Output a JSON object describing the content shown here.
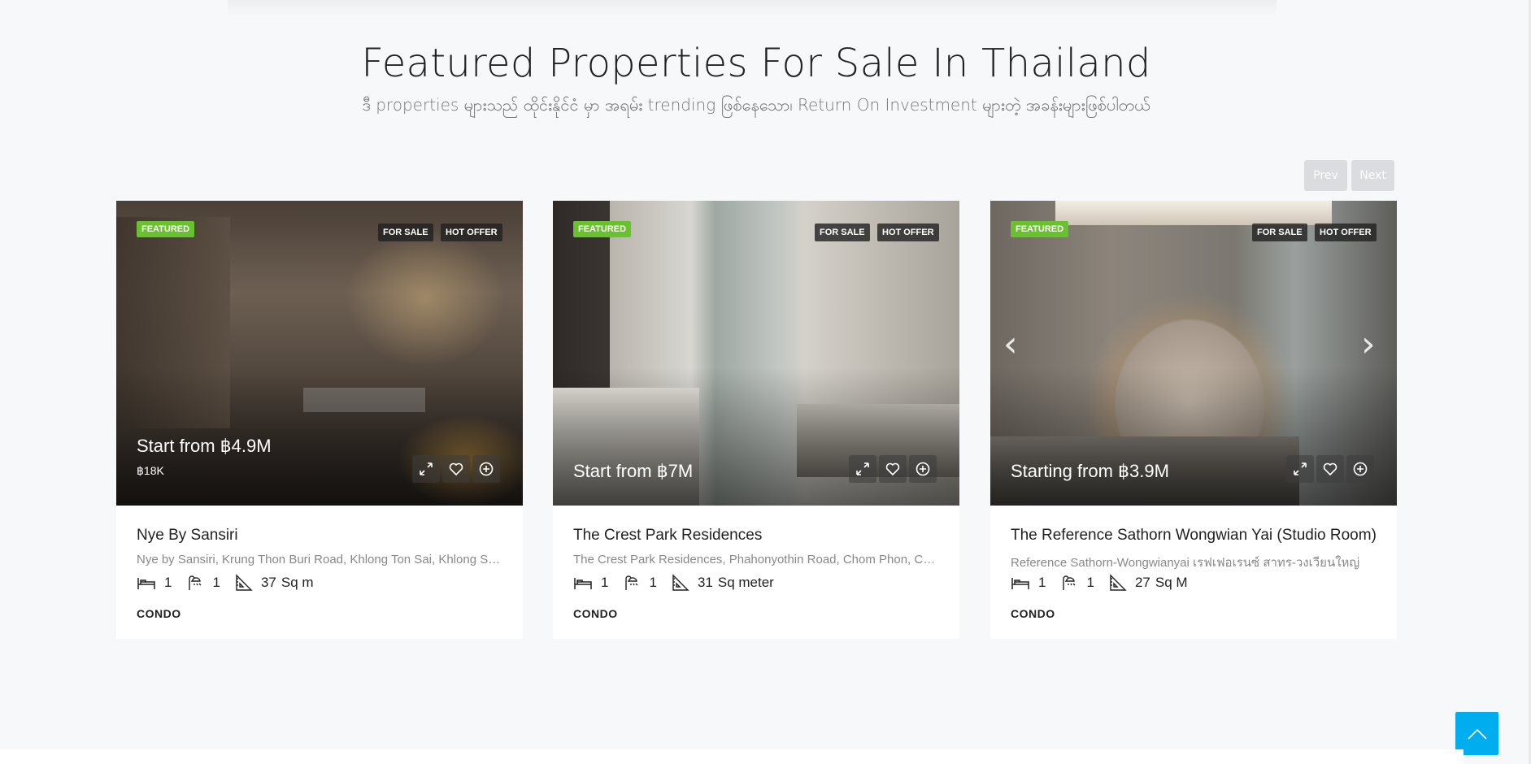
{
  "section": {
    "title": "Featured Properties For Sale In Thailand",
    "subtitle": "ဒီ properties များသည် ထိုင်းနိုင်ငံ မှာ အရမ်း trending ဖြစ်နေသော၊ Return On Investment များတဲ့ အခန်းများဖြစ်ပါတယ်"
  },
  "nav": {
    "prev_label": "Prev",
    "next_label": "Next"
  },
  "colors": {
    "featured_tag": "#68c22d",
    "accent": "#00aeef",
    "nav_button": "#dadcdf"
  },
  "cards": [
    {
      "featured": "FEATURED",
      "status": "FOR SALE",
      "offer": "HOT OFFER",
      "price": "Start from ฿4.9M",
      "price_sub": "฿18K",
      "title": "Nye By Sansiri",
      "address": "Nye by Sansiri, Krung Thon Buri Road, Khlong Ton Sai, Khlong San, Bangkok",
      "beds": "1",
      "baths": "1",
      "area": "37",
      "area_unit": "Sq m",
      "type": "CONDO"
    },
    {
      "featured": "FEATURED",
      "status": "FOR SALE",
      "offer": "HOT OFFER",
      "price": "Start from ฿7M",
      "title": "The Crest Park Residences",
      "address": "The Crest Park Residences, Phahonyothin Road, Chom Phon, Chatuchak, Bangkok",
      "beds": "1",
      "baths": "1",
      "area": "31",
      "area_unit": "Sq meter",
      "type": "CONDO"
    },
    {
      "featured": "FEATURED",
      "status": "FOR SALE",
      "offer": "HOT OFFER",
      "price": "Starting from ฿3.9M",
      "title": "The Reference Sathorn Wongwian Yai (Studio Room)",
      "address": "Reference Sathorn-Wongwianyai เรฟเฟอเรนซ์ สาทร-วงเวียนใหญ่",
      "beds": "1",
      "baths": "1",
      "area": "27",
      "area_unit": "Sq M",
      "type": "CONDO"
    }
  ],
  "icons": {
    "expand": "expand-icon",
    "favorite": "heart-icon",
    "compare": "plus-circle-icon",
    "bed": "bed-icon",
    "bath": "shower-icon",
    "area": "ruler-triangle-icon",
    "scroll_top": "chevron-up-icon"
  }
}
